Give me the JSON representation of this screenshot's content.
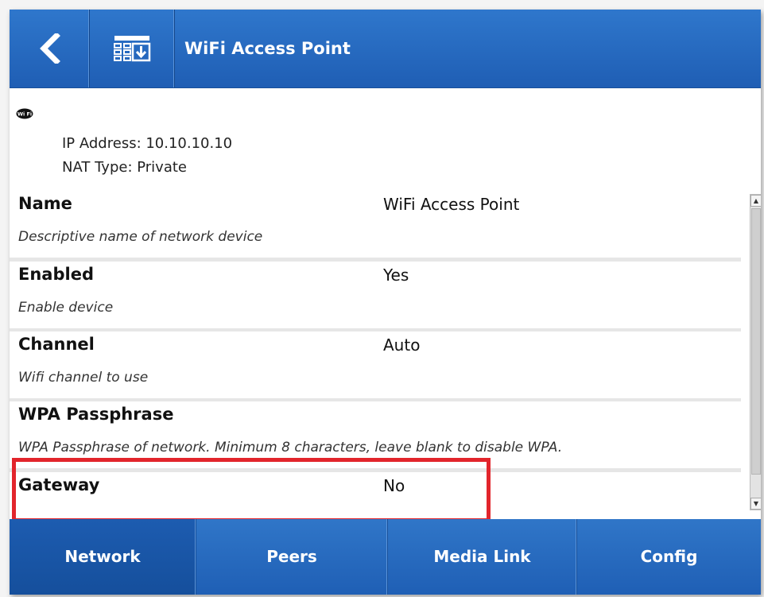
{
  "header": {
    "title": "WiFi Access Point",
    "back_icon": "chevron-left-icon",
    "menu_icon": "network-list-icon"
  },
  "info": {
    "badge_icon": "wifi-badge-icon",
    "ip_address": "IP Address: 10.10.10.10",
    "nat_type": "NAT Type: Private"
  },
  "settings": [
    {
      "name": "Name",
      "value": "WiFi Access Point",
      "description": "Descriptive name of network device"
    },
    {
      "name": "Enabled",
      "value": "Yes",
      "description": "Enable device"
    },
    {
      "name": "Channel",
      "value": "Auto",
      "description": "Wifi channel to use"
    },
    {
      "name": "WPA Passphrase",
      "value": "",
      "description": "WPA Passphrase of network. Minimum 8 characters, leave blank to disable WPA."
    },
    {
      "name": "Gateway",
      "value": "No",
      "description": ""
    }
  ],
  "tabs": [
    {
      "label": "Network",
      "active": true
    },
    {
      "label": "Peers",
      "active": false
    },
    {
      "label": "Media Link",
      "active": false
    },
    {
      "label": "Config",
      "active": false
    }
  ],
  "colors": {
    "header_blue": "#2a6dc2",
    "highlight_red": "#e2252c"
  }
}
